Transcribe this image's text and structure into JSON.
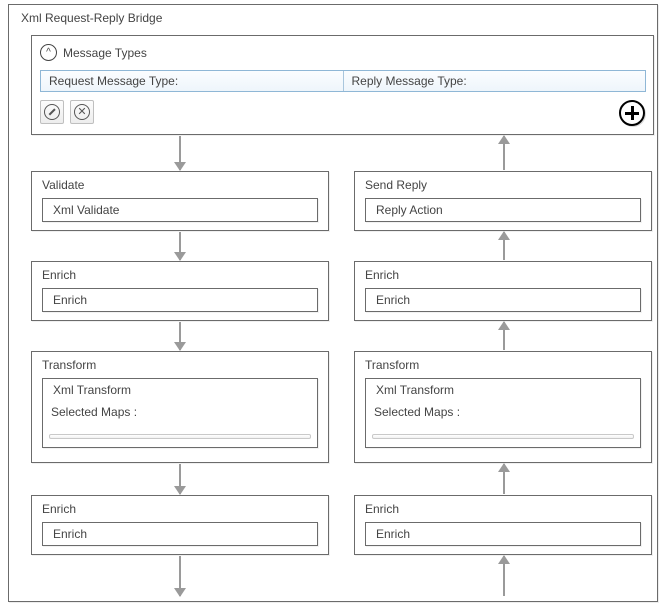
{
  "bridge": {
    "title": "Xml Request-Reply Bridge"
  },
  "messageTypes": {
    "header": "Message Types",
    "requestLabel": "Request Message Type:",
    "replyLabel": "Reply Message Type:"
  },
  "left": {
    "validate": {
      "title": "Validate",
      "inner": "Xml Validate"
    },
    "enrich1": {
      "title": "Enrich",
      "inner": "Enrich"
    },
    "transform": {
      "title": "Transform",
      "inner": "Xml Transform",
      "mapsLabel": "Selected Maps :"
    },
    "enrich2": {
      "title": "Enrich",
      "inner": "Enrich"
    }
  },
  "right": {
    "sendReply": {
      "title": "Send Reply",
      "inner": "Reply Action"
    },
    "enrich1": {
      "title": "Enrich",
      "inner": "Enrich"
    },
    "transform": {
      "title": "Transform",
      "inner": "Xml Transform",
      "mapsLabel": "Selected Maps :"
    },
    "enrich2": {
      "title": "Enrich",
      "inner": "Enrich"
    }
  }
}
